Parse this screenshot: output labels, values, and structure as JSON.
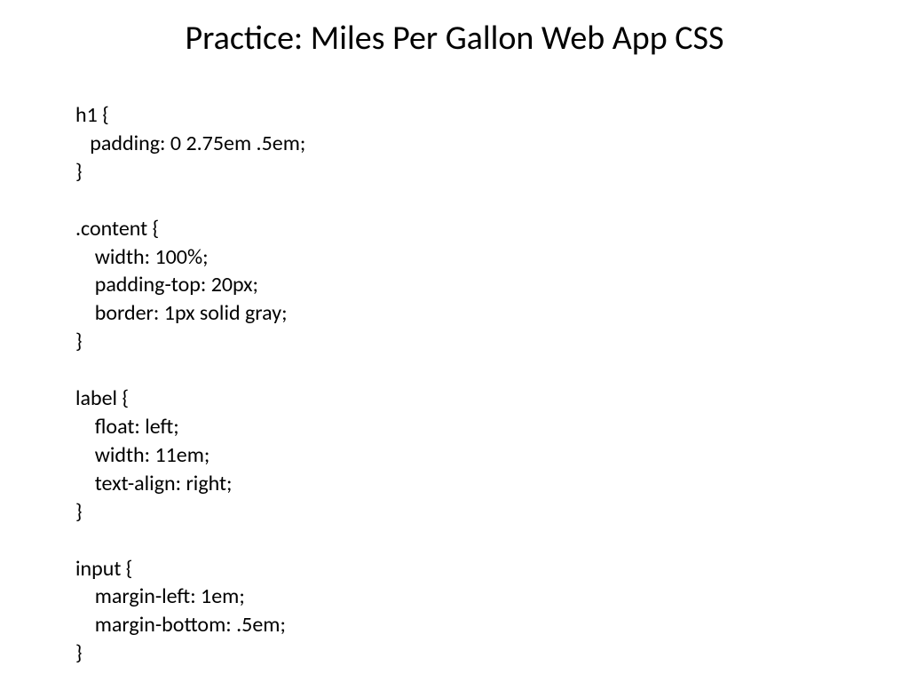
{
  "slide": {
    "title": "Practice: Miles Per Gallon Web App CSS",
    "code": "h1 {\n   padding: 0 2.75em .5em;\n}\n\n.content {\n    width: 100%;\n    padding-top: 20px;\n    border: 1px solid gray;\n}\n\nlabel {\n    float: left;\n    width: 11em;\n    text-align: right;\n}\n\ninput {\n    margin-left: 1em;\n    margin-bottom: .5em;\n}"
  }
}
